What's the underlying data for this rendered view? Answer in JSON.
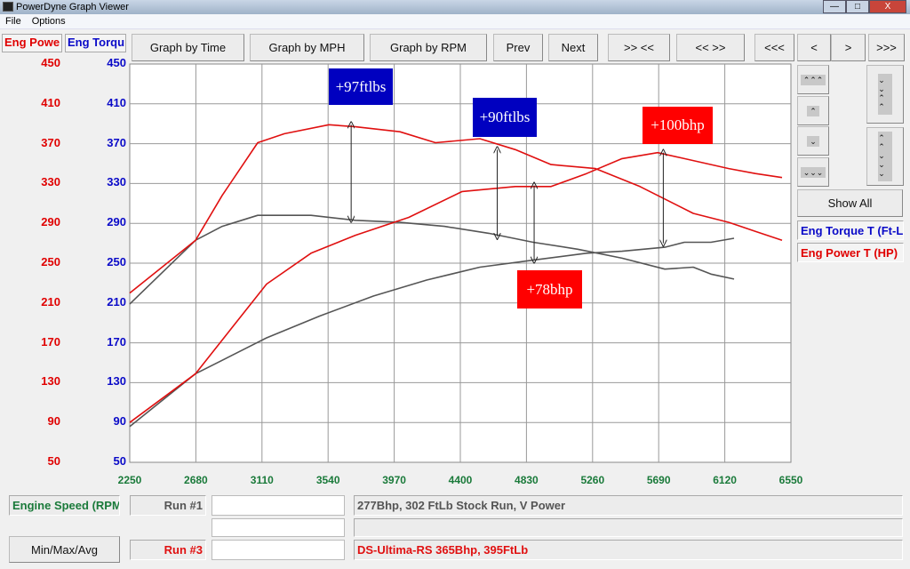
{
  "window": {
    "title": "PowerDyne Graph Viewer",
    "minimize": "—",
    "maximize": "□",
    "close": "X"
  },
  "menu": [
    "File",
    "Options"
  ],
  "left_tabs": {
    "power": "Eng Powe",
    "torque": "Eng Torqu"
  },
  "toolbar": {
    "time": "Graph by Time",
    "mph": "Graph by MPH",
    "rpm": "Graph by RPM",
    "prev": "Prev",
    "next": "Next",
    "zoom_in": ">> <<",
    "zoom_out": "<< >>",
    "first": "<<<",
    "left": "<",
    "right": ">",
    "last": ">>>"
  },
  "side": {
    "up_fast": "⌃⌃⌃",
    "up": "⌃",
    "down": "⌄",
    "down_fast": "⌄⌄⌄",
    "expand": "⌄⌄⌃⌃",
    "shrink": "⌃⌃⌄⌄⌄",
    "show_all": "Show All",
    "legend_torque": "Eng Torque T (Ft-L",
    "legend_power": "Eng Power T (HP)"
  },
  "colors": {
    "power": "#e00000",
    "torque": "#0a0ac8",
    "rpm": "#1a7a3a",
    "run1": "#555555",
    "run3": "#e01010"
  },
  "chart_data": {
    "type": "line",
    "xlabel": "Engine Speed (RPM",
    "xlim": [
      2250,
      6550
    ],
    "ylim": [
      50,
      450
    ],
    "x_ticks": [
      "2250",
      "2680",
      "3110",
      "3540",
      "3970",
      "4400",
      "4830",
      "5260",
      "5690",
      "6120",
      "6550"
    ],
    "y_ticks_power": [
      "450",
      "410",
      "370",
      "330",
      "290",
      "250",
      "210",
      "170",
      "130",
      "90",
      "50"
    ],
    "y_ticks_torque": [
      "450",
      "410",
      "370",
      "330",
      "290",
      "250",
      "210",
      "170",
      "130",
      "90",
      "50"
    ],
    "grid": true,
    "series": [
      {
        "run": "Run #1",
        "measure": "torque",
        "color": "#555555",
        "points": [
          [
            2250,
            209
          ],
          [
            2678,
            273
          ],
          [
            2851,
            287
          ],
          [
            3082,
            298
          ],
          [
            3429,
            298
          ],
          [
            3718,
            293
          ],
          [
            4007,
            291
          ],
          [
            4296,
            287
          ],
          [
            4585,
            280
          ],
          [
            4874,
            271
          ],
          [
            5163,
            264
          ],
          [
            5452,
            255
          ],
          [
            5730,
            244
          ],
          [
            5915,
            246
          ],
          [
            6030,
            239
          ],
          [
            6180,
            234
          ]
        ]
      },
      {
        "run": "Run #1",
        "measure": "power",
        "color": "#555555",
        "points": [
          [
            2250,
            86
          ],
          [
            2678,
            139
          ],
          [
            2909,
            157
          ],
          [
            3140,
            175
          ],
          [
            3487,
            197
          ],
          [
            3834,
            217
          ],
          [
            4181,
            233
          ],
          [
            4527,
            246
          ],
          [
            4874,
            253
          ],
          [
            5221,
            260
          ],
          [
            5452,
            262
          ],
          [
            5730,
            266
          ],
          [
            5857,
            271
          ],
          [
            6030,
            271
          ],
          [
            6180,
            275
          ]
        ]
      },
      {
        "run": "Run #3",
        "measure": "torque",
        "color": "#e01010",
        "points": [
          [
            2250,
            220
          ],
          [
            2678,
            273
          ],
          [
            2851,
            318
          ],
          [
            3082,
            371
          ],
          [
            3256,
            380
          ],
          [
            3545,
            389
          ],
          [
            3718,
            387
          ],
          [
            4007,
            382
          ],
          [
            4238,
            371
          ],
          [
            4527,
            375
          ],
          [
            4758,
            364
          ],
          [
            4990,
            349
          ],
          [
            5279,
            345
          ],
          [
            5568,
            327
          ],
          [
            5915,
            300
          ],
          [
            6146,
            291
          ],
          [
            6319,
            282
          ],
          [
            6492,
            273
          ]
        ]
      },
      {
        "run": "Run #3",
        "measure": "power",
        "color": "#e01010",
        "points": [
          [
            2250,
            90
          ],
          [
            2678,
            139
          ],
          [
            2909,
            184
          ],
          [
            3140,
            229
          ],
          [
            3429,
            260
          ],
          [
            3718,
            278
          ],
          [
            4065,
            296
          ],
          [
            4412,
            322
          ],
          [
            4758,
            327
          ],
          [
            4990,
            327
          ],
          [
            5221,
            340
          ],
          [
            5452,
            355
          ],
          [
            5683,
            361
          ],
          [
            5857,
            355
          ],
          [
            6146,
            345
          ],
          [
            6319,
            340
          ],
          [
            6492,
            336
          ]
        ]
      }
    ],
    "annotations": [
      {
        "text": "+97ftlbs",
        "color": "#0000c0"
      },
      {
        "text": "+90ftlbs",
        "color": "#0000c0"
      },
      {
        "text": "+100bhp",
        "color": "#ff0000"
      },
      {
        "text": "+78bhp",
        "color": "#ff0000"
      }
    ],
    "arrows": [
      [
        3690,
        389,
        294
      ],
      [
        4640,
        364,
        277
      ],
      [
        4880,
        328,
        253
      ],
      [
        5720,
        361,
        270
      ]
    ]
  },
  "bottom": {
    "xaxis_label": "Engine Speed (RPM",
    "minmax": "Min/Max/Avg",
    "run1": "Run #1",
    "run1_desc": "277Bhp, 302 FtLb Stock Run, V Power",
    "run3": "Run #3",
    "run3_desc": "DS-Ultima-RS 365Bhp, 395FtLb"
  }
}
